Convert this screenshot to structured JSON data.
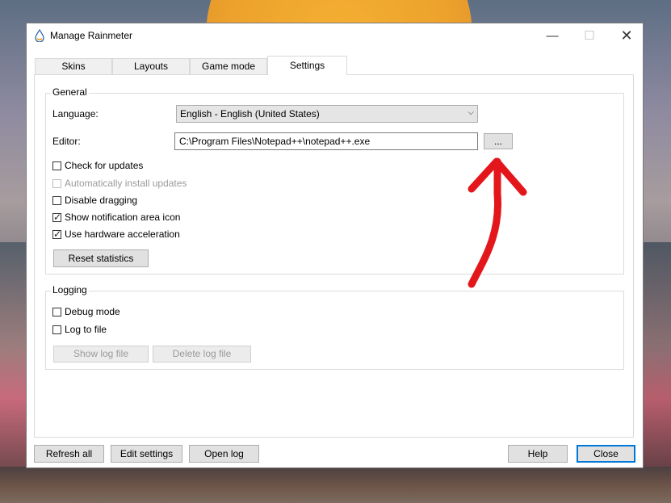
{
  "window": {
    "title": "Manage Rainmeter",
    "controls": {
      "minimize": "—",
      "maximize": "☐",
      "close": "✕"
    }
  },
  "tabs": [
    {
      "label": "Skins"
    },
    {
      "label": "Layouts"
    },
    {
      "label": "Game mode"
    },
    {
      "label": "Settings",
      "active": true
    }
  ],
  "general": {
    "group_label": "General",
    "language_label": "Language:",
    "language_value": "English - English (United States)",
    "editor_label": "Editor:",
    "editor_value": "C:\\Program Files\\Notepad++\\notepad++.exe",
    "browse_label": "...",
    "checkboxes": [
      {
        "label": "Check for updates",
        "checked": false,
        "enabled": true
      },
      {
        "label": "Automatically install updates",
        "checked": false,
        "enabled": false
      },
      {
        "label": "Disable dragging",
        "checked": false,
        "enabled": true
      },
      {
        "label": "Show notification area icon",
        "checked": true,
        "enabled": true
      },
      {
        "label": "Use hardware acceleration",
        "checked": true,
        "enabled": true
      }
    ],
    "reset_label": "Reset statistics"
  },
  "logging": {
    "group_label": "Logging",
    "checkboxes": [
      {
        "label": "Debug mode",
        "checked": false,
        "enabled": true
      },
      {
        "label": "Log to file",
        "checked": false,
        "enabled": true
      }
    ],
    "show_log_label": "Show log file",
    "delete_log_label": "Delete log file"
  },
  "footer": {
    "refresh_label": "Refresh all",
    "edit_settings_label": "Edit settings",
    "open_log_label": "Open log",
    "help_label": "Help",
    "close_label": "Close"
  },
  "colors": {
    "accent": "#0078d7",
    "annotation_arrow": "#e3161b"
  },
  "icons": {
    "app": "rainmeter-drop-icon",
    "dropdown": "chevron-down-icon",
    "check": "checkmark-icon"
  }
}
